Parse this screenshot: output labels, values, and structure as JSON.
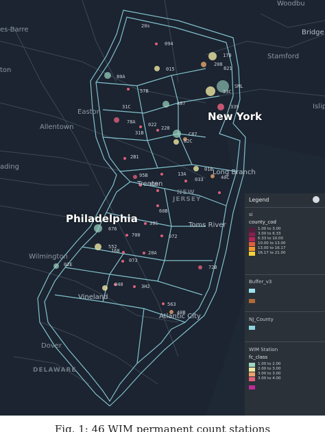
{
  "map": {
    "colors": {
      "background": "#1b2430",
      "boundary": "#8fd3e0",
      "roads": "#3b4552",
      "water": "#26303c"
    },
    "places": {
      "wilkes_barre": "Wilkes Barre",
      "wilkes_barre_prefix": "es-Barre",
      "scranton": "ton",
      "reading": "ading",
      "allentown": "Allentown",
      "easton": "Easton",
      "new_york": "New York",
      "philadelphia": "Philadelphia",
      "trenton": "Trenton",
      "new_jersey_1": "NEW",
      "new_jersey_2": "JERSEY",
      "toms_river": "Toms River",
      "long_branch": "Long Branch",
      "wilmington": "Wilmington",
      "vineland": "Vineland",
      "atlantic_city": "Atlantic City",
      "dover": "Dover",
      "delaware": "DELAWARE",
      "stamford": "Stamford",
      "bridgeport": "Bridge",
      "islip": "Islip",
      "top_right": "Woodbu"
    },
    "stations": [
      "20s",
      "094",
      "17B",
      "208",
      "821",
      "80A",
      "015",
      "57B",
      "SML",
      "33C",
      "339",
      "31C",
      "A87",
      "78A",
      "022",
      "228",
      "C87",
      "31B",
      "82C",
      "2B1",
      "95B",
      "13A",
      "01B",
      "033",
      "40C",
      "01M",
      "60B",
      "39S",
      "676",
      "700",
      "072",
      "552",
      "168",
      "073",
      "20A",
      "02E",
      "72B",
      "040",
      "3H2",
      "563",
      "40B"
    ]
  },
  "legend": {
    "title": "Legend",
    "si_section": "si",
    "si_field": "county_cod",
    "si_classes": [
      {
        "label": "1.00 to 3.00",
        "color": "#5a1a3c"
      },
      {
        "label": "3.00 to 6.33",
        "color": "#8a1f4f"
      },
      {
        "label": "6.33 to 10.00",
        "color": "#b7245a"
      },
      {
        "label": "10.00 to 13.00",
        "color": "#e0603a"
      },
      {
        "label": "13.00 to 16.17",
        "color": "#f39b2c"
      },
      {
        "label": "16.17 to 21.00",
        "color": "#f8d23a"
      }
    ],
    "buffer_section": "Buffer_v3",
    "buffer_colors": [
      "#9fe3ee",
      "#b06a3a"
    ],
    "county_section": "NJ_County",
    "county_color": "#8fd3e0",
    "wim_section": "WIM Station",
    "wim_field": "fc_class",
    "wim_classes": [
      {
        "label": "1.00 to 2.00",
        "color": "#9ed7c4"
      },
      {
        "label": "2.00 to 3.00",
        "color": "#efe7a2"
      },
      {
        "label": "3.00 to 3.00",
        "color": "#e9a36a"
      },
      {
        "label": "3.00 to 4.00",
        "color": "#e0607a"
      }
    ],
    "wim_extra_color": "#c02b9a"
  },
  "caption": "Fig. 1: 46 WIM permanent count stations"
}
